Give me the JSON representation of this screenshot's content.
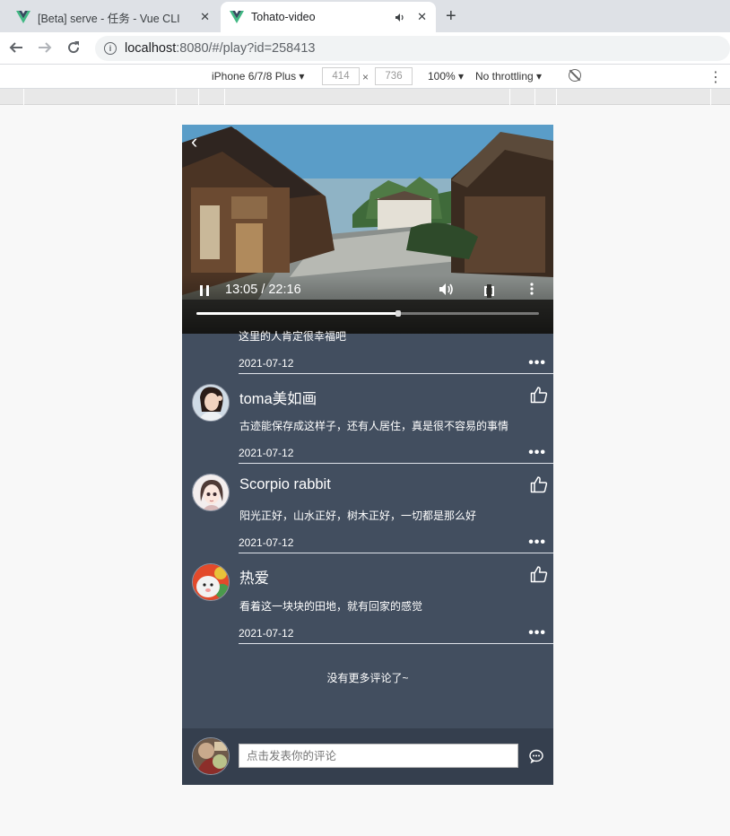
{
  "browser": {
    "tabs": [
      {
        "title": "[Beta] serve - 任务 - Vue CLI",
        "close": "✕"
      },
      {
        "title": "Tohato-video",
        "close": "✕"
      }
    ],
    "new_tab": "+",
    "url": {
      "host": "localhost",
      "path": ":8080/#/play?id=258413"
    }
  },
  "device_toolbar": {
    "device": "iPhone 6/7/8 Plus ▾",
    "width": "414",
    "times": "×",
    "height": "736",
    "zoom": "100% ▾",
    "throttling": "No throttling ▾"
  },
  "player": {
    "back": "‹",
    "time": "13:05 / 22:16",
    "progress": 0.59
  },
  "comments": {
    "partial_text": "这里的人肯定很幸福吧",
    "partial_date": "2021-07-12",
    "items": [
      {
        "name": "toma美如画",
        "text": "古迹能保存成这样子，还有人居住，真是很不容易的事情",
        "date": "2021-07-12"
      },
      {
        "name": "Scorpio rabbit",
        "text": "阳光正好，山水正好，树木正好，一切都是那么好",
        "date": "2021-07-12"
      },
      {
        "name": "热爱",
        "text": "看着这一块块的田地，就有回家的感觉",
        "date": "2021-07-12"
      }
    ],
    "more_icon": "•••",
    "no_more": "没有更多评论了~"
  },
  "input": {
    "placeholder": "点击发表你的评论"
  },
  "colors": {
    "panel_bg": "#424e5f",
    "input_bar_bg": "#353f4e"
  }
}
